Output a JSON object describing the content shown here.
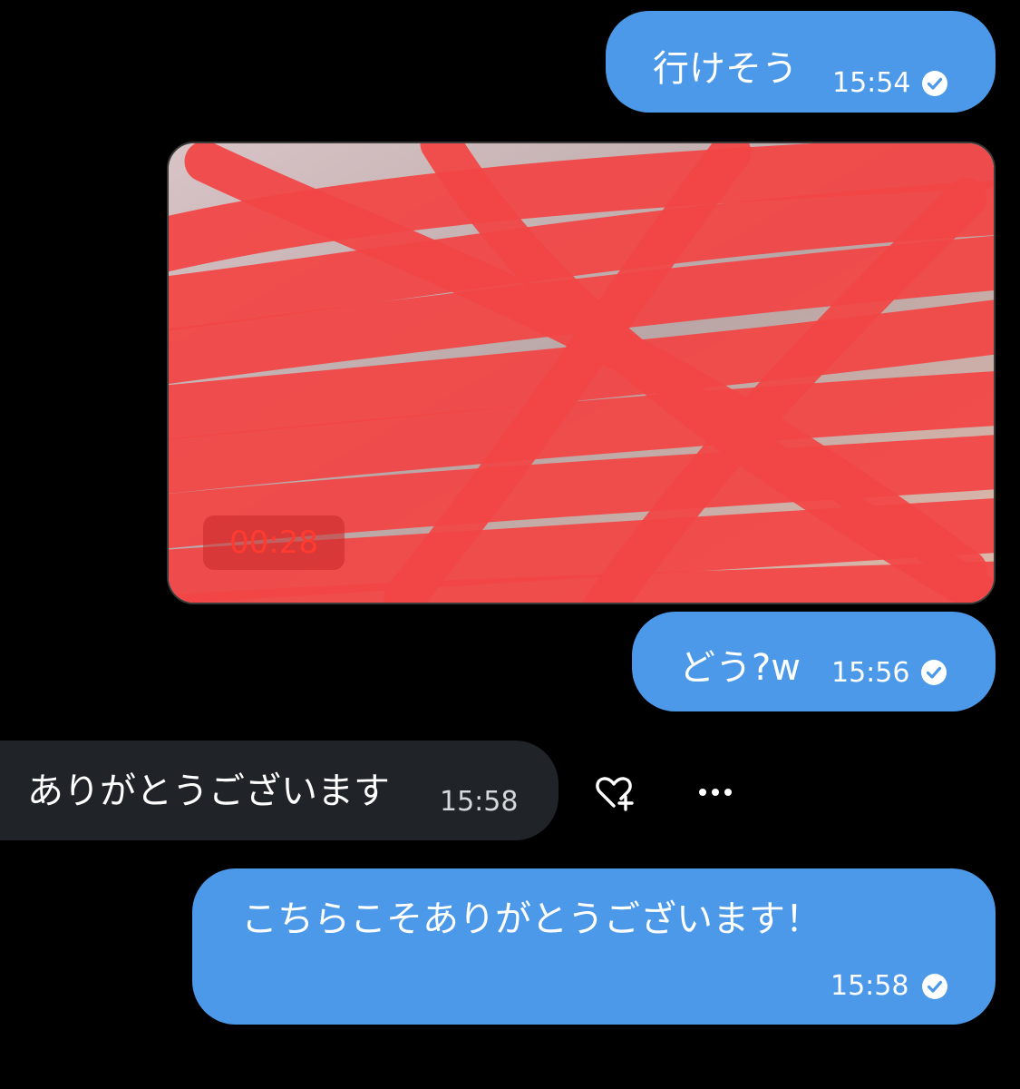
{
  "colors": {
    "outgoing_bubble": "#4c99e9",
    "incoming_bubble": "#202327",
    "background": "#000000",
    "redaction": "#ff3b3b"
  },
  "messages": [
    {
      "id": "b1",
      "direction": "outgoing",
      "text": "行けそう",
      "time": "15:54",
      "status_icon": "read-check-icon"
    },
    {
      "id": "media",
      "direction": "outgoing",
      "type": "video",
      "duration": "00:28",
      "redacted": true
    },
    {
      "id": "b2",
      "direction": "outgoing",
      "text": "どう?w",
      "time": "15:56",
      "status_icon": "read-check-icon"
    },
    {
      "id": "b3",
      "direction": "incoming",
      "text": "ありがとうございます",
      "time": "15:58"
    },
    {
      "id": "b4",
      "direction": "outgoing",
      "text": "こちらこそありがとうございます！",
      "time": "15:58",
      "status_icon": "read-check-icon"
    }
  ],
  "actions": {
    "react_icon": "heart-plus-icon",
    "more_icon": "more-horizontal-icon"
  }
}
